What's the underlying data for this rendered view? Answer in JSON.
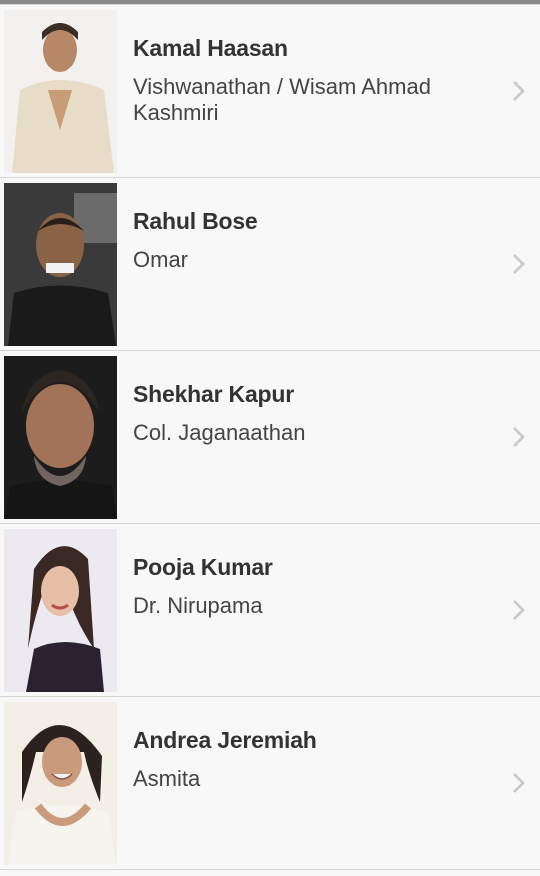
{
  "cast": [
    {
      "name": "Kamal Haasan",
      "role": "Vishwanathan / Wisam Ahmad Kashmiri",
      "photo_icon": "actor-photo"
    },
    {
      "name": "Rahul Bose",
      "role": "Omar",
      "photo_icon": "actor-photo"
    },
    {
      "name": "Shekhar Kapur",
      "role": "Col. Jaganaathan",
      "photo_icon": "actor-photo"
    },
    {
      "name": "Pooja Kumar",
      "role": "Dr. Nirupama",
      "photo_icon": "actress-photo"
    },
    {
      "name": "Andrea Jeremiah",
      "role": "Asmita",
      "photo_icon": "actress-photo"
    }
  ],
  "colors": {
    "chevron": "#c8c8c8",
    "divider": "#d4d4d4",
    "background": "#f8f8f8"
  }
}
